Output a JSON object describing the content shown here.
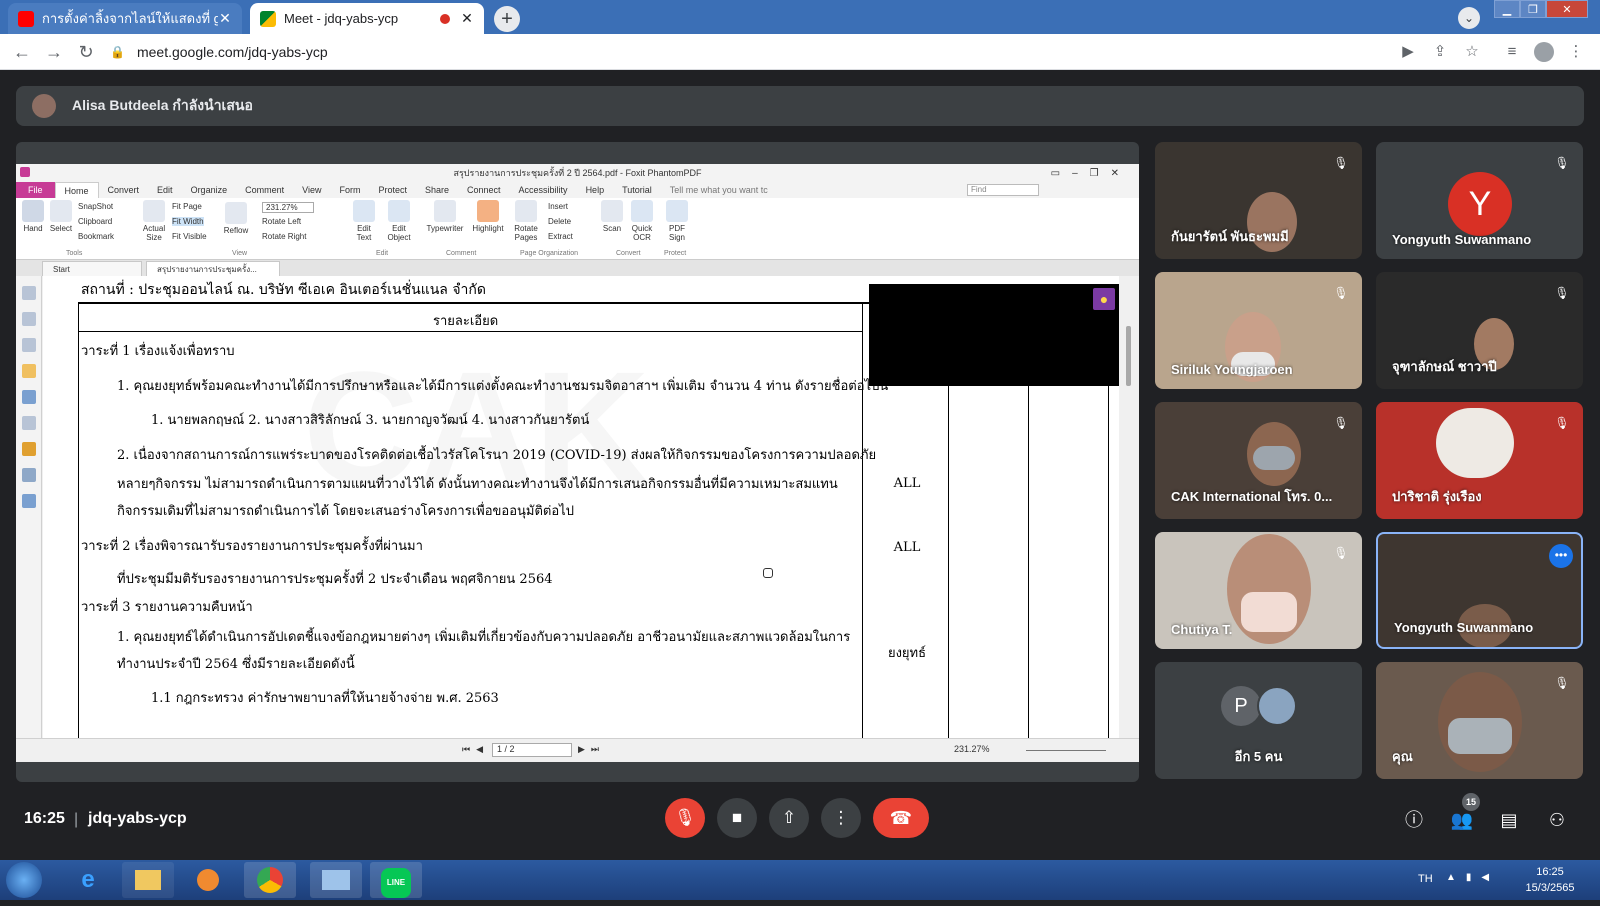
{
  "browser": {
    "tabs": [
      {
        "title": "การตั้งค่าลิ้งจากไลน์ให้แสดงที่ google",
        "active": false
      },
      {
        "title": "Meet - jdq-yabs-ycp",
        "active": true
      }
    ],
    "new_tab": "+",
    "url": "meet.google.com/jdq-yabs-ycp"
  },
  "meet": {
    "presenting_text": "Alisa Butdeela กำลังนำเสนอ",
    "time": "16:25",
    "separator": "|",
    "code": "jdq-yabs-ycp",
    "people_count": "15",
    "participants": [
      {
        "name": "กันยารัตน์ พันธะพมมี",
        "muted": true
      },
      {
        "name": "Yongyuth Suwanmano",
        "muted": true,
        "avatar_letter": "Y"
      },
      {
        "name": "Siriluk Youngjaroen",
        "muted": true
      },
      {
        "name": "จุฑาลักษณ์ ชาวาปี",
        "muted": true
      },
      {
        "name": "CAK International โทร. 0...",
        "muted": true
      },
      {
        "name": "ปาริชาติ รุ่งเรือง",
        "muted": true
      },
      {
        "name": "Chutiya T.",
        "muted": true
      },
      {
        "name": "Yongyuth Suwanmano",
        "muted": false
      },
      {
        "name": "อีก 5 คน",
        "avatar_letter": "P"
      },
      {
        "name": "คุณ",
        "muted": true
      }
    ]
  },
  "foxit": {
    "title": "สรุปรายงานการประชุมครั้งที่ 2 ปี 2564.pdf - Foxit PhantomPDF",
    "menu": [
      "File",
      "Home",
      "Convert",
      "Edit",
      "Organize",
      "Comment",
      "View",
      "Form",
      "Protect",
      "Share",
      "Connect",
      "Accessibility",
      "Help",
      "Tutorial"
    ],
    "tell_me": "Tell me what you want tc",
    "find_placeholder": "Find",
    "ribbon": {
      "hand": "Hand",
      "select": "Select",
      "snapshot": "SnapShot",
      "clipboard": "Clipboard",
      "bookmark": "Bookmark",
      "actual_size": "Actual Size",
      "fit_page": "Fit Page",
      "fit_width": "Fit Width",
      "fit_visible": "Fit Visible",
      "zoom": "231.27%",
      "reflow": "Reflow",
      "rotate_left": "Rotate Left",
      "rotate_right": "Rotate Right",
      "edit_text": "Edit Text",
      "edit_object": "Edit Object",
      "typewriter": "Typewriter",
      "highlight": "Highlight",
      "rotate_pages": "Rotate Pages",
      "insert": "Insert",
      "delete": "Delete",
      "extract": "Extract",
      "scan": "Scan",
      "quick_ocr": "Quick OCR",
      "pdf_sign": "PDF Sign",
      "groups": [
        "Tools",
        "View",
        "Edit",
        "Comment",
        "Page Organization",
        "Convert",
        "Protect"
      ]
    },
    "doc_tabs": [
      "Start",
      "สรุปรายงานการประชุมครั้ง..."
    ],
    "page_indicator": "1 / 2",
    "status_zoom": "231.27%",
    "watermark": "CAK",
    "document": {
      "location": "สถานที่ : ประชุมออนไลน์ ณ. บริษัท ซีเอเค อินเตอร์เนชั่นแนล จำกัด",
      "header": "รายละเอียด",
      "lines": [
        "วาระที่ 1 เรื่องแจ้งเพื่อทราบ",
        "1. คุณยงยุทธ์พร้อมคณะทำงานได้มีการปรึกษาหรือและได้มีการแต่งตั้งคณะทำงานชมรมจิตอาสาฯ เพิ่มเติม จำนวน 4 ท่าน ดังรายชื่อต่อไปนี้",
        "1. นายพลกฤษณ์   2. นางสาวสิริลักษณ์   3. นายกาญจวัฒน์   4. นางสาวกันยารัตน์",
        "2. เนื่องจากสถานการณ์การแพร่ระบาดของโรคติดต่อเชื้อไวรัสโคโรนา 2019 (COVID-19) ส่งผลให้กิจกรรมของโครงการความปลอดภัย",
        "หลายๆกิจกรรม ไม่สามารถดำเนินการตามแผนที่วางไว้ได้ ดังนั้นทางคณะทำงานจึงได้มีการเสนอกิจกรรมอื่นที่มีความเหมาะสมแทน",
        "กิจกรรมเดิมที่ไม่สามารถดำเนินการได้ โดยจะเสนอร่างโครงการเพื่อขออนุมัติต่อไป",
        "วาระที่ 2 เรื่องพิจารณารับรองรายงานการประชุมครั้งที่ผ่านมา",
        "ที่ประชุมมีมติรับรองรายงานการประชุมครั้งที่ 2 ประจำเดือน พฤศจิกายน 2564",
        "วาระที่ 3  รายงานความคืบหน้า",
        "1. คุณยงยุทธ์ได้ดำเนินการอัปเดตชี้แจงข้อกฎหมายต่างๆ เพิ่มเติมที่เกี่ยวข้องกับความปลอดภัย อาชีวอนามัยและสภาพแวดล้อมในการ",
        "ทำงานประจำปี 2564 ซึ่งมีรายละเอียดดังนี้",
        "1.1 กฎกระทรวง ค่ารักษาพยาบาลที่ให้นายจ้างจ่าย พ.ศ. 2563"
      ],
      "responsible": [
        "ALL",
        "ALL",
        "ยงยุทธ์"
      ]
    }
  },
  "taskbar": {
    "lang": "TH",
    "time": "16:25",
    "date": "15/3/2565",
    "line_label": "LINE"
  }
}
